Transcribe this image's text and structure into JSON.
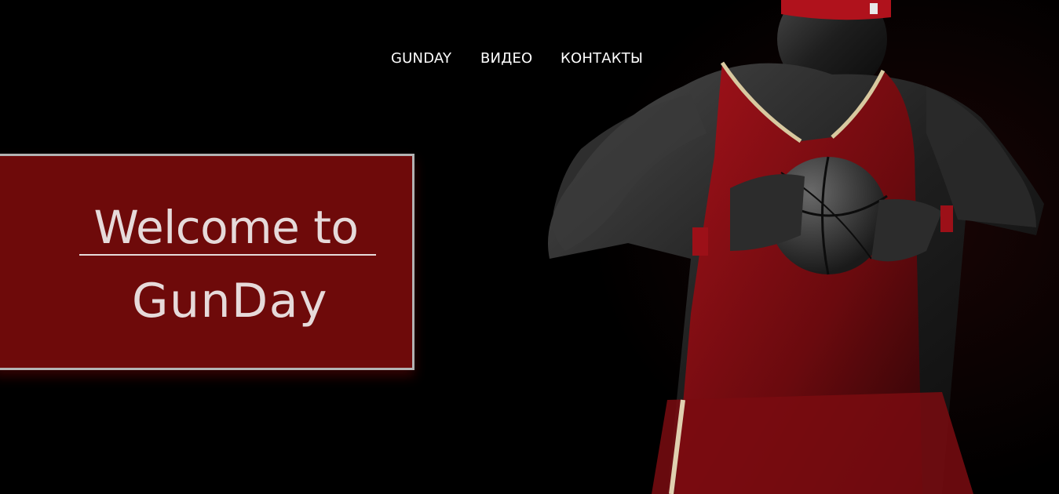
{
  "nav": {
    "items": [
      {
        "label": "GUNDAY"
      },
      {
        "label": "ВИДЕО"
      },
      {
        "label": "КОНТАКТЫ"
      }
    ]
  },
  "hero": {
    "line1": "Welcome to",
    "line2": "GunDay",
    "image": "basketball-player-photo"
  },
  "colors": {
    "background": "#000000",
    "box_fill": "#6e0a0a",
    "box_border": "#b3b3b3",
    "text": "#e6dada",
    "jersey_red": "#8c0f14"
  }
}
